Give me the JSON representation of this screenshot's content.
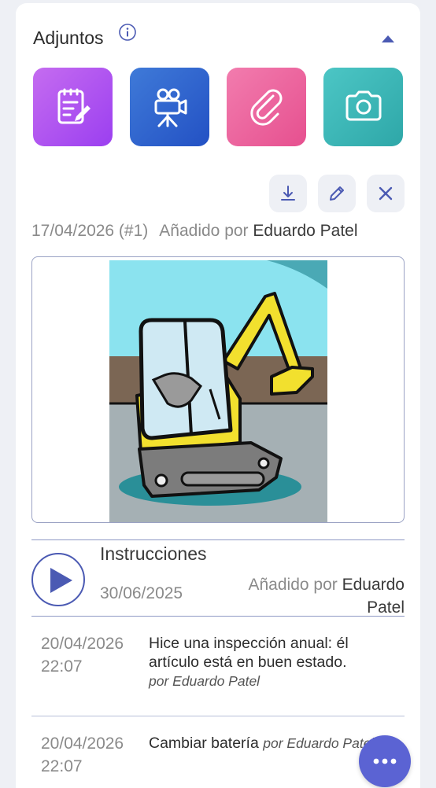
{
  "section": {
    "title": "Adjuntos",
    "info_icon": "info-circle-icon",
    "collapse_icon": "chevron-up-icon"
  },
  "attachment_types": [
    {
      "name": "note",
      "icon": "note-edit-icon",
      "color": "#b04cf2"
    },
    {
      "name": "video",
      "icon": "video-camera-icon",
      "color": "#2f5fcc"
    },
    {
      "name": "file",
      "icon": "paperclip-icon",
      "color": "#ea5f9a"
    },
    {
      "name": "photo",
      "icon": "camera-icon",
      "color": "#36b2b2"
    }
  ],
  "attachment_actions": [
    {
      "name": "download",
      "icon": "download-icon"
    },
    {
      "name": "edit",
      "icon": "pencil-icon"
    },
    {
      "name": "delete",
      "icon": "close-icon"
    }
  ],
  "current_attachment": {
    "date": "17/04/2026 (#1)",
    "added_by_label": "Añadido por",
    "author": "Eduardo Patel",
    "image": "excavator-drawing"
  },
  "file_item": {
    "name": "Instrucciones",
    "date": "30/06/2025",
    "added_by_label": "Añadido por",
    "author": "Eduardo Patel",
    "icon": "play-icon"
  },
  "log": [
    {
      "date": "20/04/2026 22:07",
      "text": "Hice una inspección anual: él artículo está en buen estado.",
      "by": "por Eduardo Patel"
    },
    {
      "date": "20/04/2026 22:07",
      "text": "Cambiar batería",
      "by": "por Eduardo Patel"
    }
  ],
  "fab": {
    "icon": "more-horizontal-icon"
  },
  "colors": {
    "accent": "#5b63d3",
    "border": "#8e98c4",
    "muted_text": "#8a8a8a"
  }
}
